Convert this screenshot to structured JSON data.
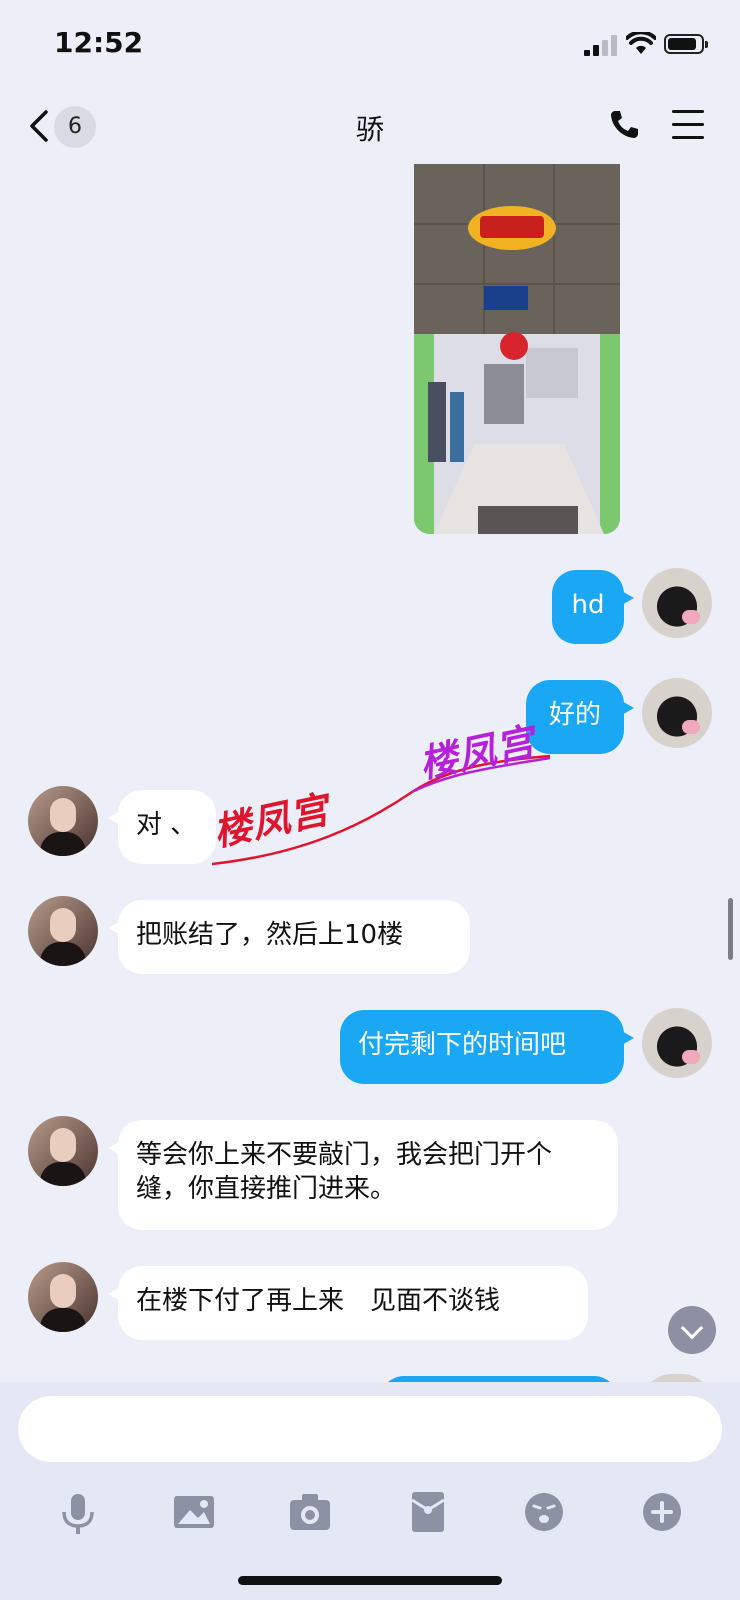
{
  "status_bar": {
    "time": "12:52"
  },
  "header": {
    "back_badge": "6",
    "title": "骄"
  },
  "messages": [
    {
      "side": "out",
      "text": "hd"
    },
    {
      "side": "out",
      "text": "好的"
    },
    {
      "side": "in",
      "text": "对 、"
    },
    {
      "side": "in",
      "text": "把账结了，然后上10楼"
    },
    {
      "side": "out",
      "text": "付完剩下的时间吧"
    },
    {
      "side": "in",
      "text": "等会你上来不要敲门，我会把门开个缝，你直接推门进来。"
    },
    {
      "side": "in",
      "text": "在楼下付了再上来　见面不谈钱"
    }
  ],
  "watermark": {
    "text_red": "楼凤宫",
    "text_purple": "楼凤宫"
  },
  "toolbar": {
    "icons": [
      "mic-icon",
      "image-icon",
      "camera-icon",
      "red-packet-icon",
      "emoji-icon",
      "plus-icon"
    ]
  },
  "colors": {
    "outgoing_bubble": "#1aa8f5",
    "incoming_bubble": "#ffffff",
    "background": "#eceef8"
  }
}
